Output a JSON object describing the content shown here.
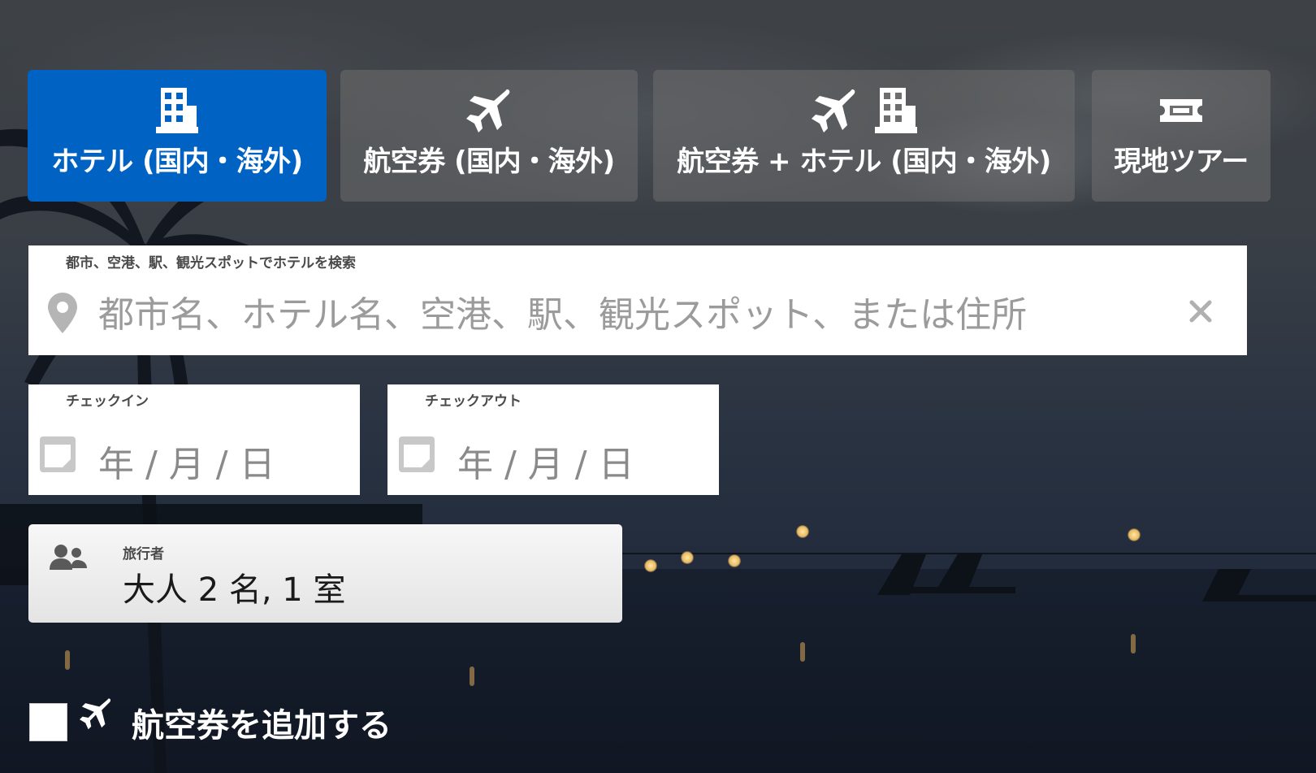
{
  "tabs": [
    {
      "label": "ホテル (国内・海外)",
      "active": true,
      "icons": [
        "building-icon"
      ]
    },
    {
      "label": "航空券 (国内・海外)",
      "active": false,
      "icons": [
        "airplane-icon"
      ]
    },
    {
      "label": "航空券 + ホテル (国内・海外)",
      "active": false,
      "icons": [
        "airplane-icon",
        "building-icon"
      ]
    },
    {
      "label": "現地ツアー",
      "active": false,
      "icons": [
        "ticket-icon"
      ]
    }
  ],
  "search": {
    "caption": "都市、空港、駅、観光スポットでホテルを検索",
    "placeholder": "都市名、ホテル名、空港、駅、観光スポット、または住所",
    "value": "",
    "clear_icon": "close-icon",
    "lead_icon": "location-pin-icon"
  },
  "checkin": {
    "caption": "チェックイン",
    "value": "年 / 月 / 日",
    "icon": "calendar-icon"
  },
  "checkout": {
    "caption": "チェックアウト",
    "value": "年 / 月 / 日",
    "icon": "calendar-icon"
  },
  "travelers": {
    "caption": "旅行者",
    "value": "大人 2 名, 1 室",
    "icon": "people-icon"
  },
  "add_flight": {
    "label": "航空券を追加する",
    "checked": false,
    "icon": "airplane-icon"
  },
  "colors": {
    "active_tab": "#0063c4",
    "inactive_tab": "rgba(110,110,110,0.55)",
    "text_light": "#ffffff"
  }
}
